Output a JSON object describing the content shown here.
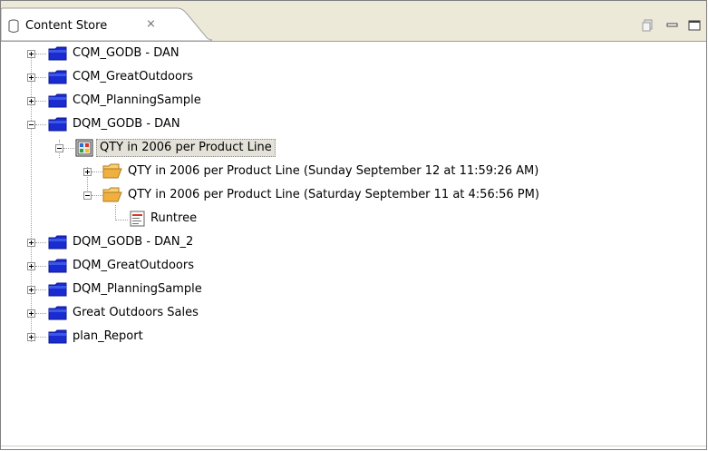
{
  "view": {
    "tab_title": "Content Store",
    "tab_icon": "cylinder-icon",
    "close_glyph": "⨯",
    "toolbar_icons": [
      "restore-icon",
      "minimize-icon",
      "maximize-icon"
    ]
  },
  "tree": {
    "items": [
      {
        "label": "CQM_GODB - DAN",
        "icon": "folder-icon",
        "expanded": false,
        "level": 0
      },
      {
        "label": "CQM_GreatOutdoors",
        "icon": "folder-icon",
        "expanded": false,
        "level": 0
      },
      {
        "label": "CQM_PlanningSample",
        "icon": "folder-icon",
        "expanded": false,
        "level": 0
      },
      {
        "label": "DQM_GODB - DAN",
        "icon": "folder-icon",
        "expanded": true,
        "level": 0
      },
      {
        "label": "QTY in 2006 per Product Line",
        "icon": "report-icon",
        "expanded": true,
        "level": 1,
        "selected": true
      },
      {
        "label": "QTY in 2006 per Product Line (Sunday September 12 at 11:59:26 AM)",
        "icon": "open-folder-icon",
        "expanded": false,
        "level": 2
      },
      {
        "label": "QTY in 2006 per Product Line (Saturday September 11 at 4:56:56 PM)",
        "icon": "open-folder-icon",
        "expanded": true,
        "level": 2
      },
      {
        "label": "Runtree",
        "icon": "runtree-icon",
        "level": 3
      },
      {
        "label": "DQM_GODB - DAN_2",
        "icon": "folder-icon",
        "expanded": false,
        "level": 0
      },
      {
        "label": "DQM_GreatOutdoors",
        "icon": "folder-icon",
        "expanded": false,
        "level": 0
      },
      {
        "label": "DQM_PlanningSample",
        "icon": "folder-icon",
        "expanded": false,
        "level": 0
      },
      {
        "label": "Great Outdoors Sales",
        "icon": "folder-icon",
        "expanded": false,
        "level": 0
      },
      {
        "label": "plan_Report",
        "icon": "folder-icon",
        "expanded": false,
        "level": 0
      }
    ]
  },
  "colors": {
    "folder_blue": "#1a2bd0",
    "folder_open_orange": "#f0b040",
    "selection_bg": "#e4e2d8",
    "tab_bg": "#ece9d8"
  }
}
